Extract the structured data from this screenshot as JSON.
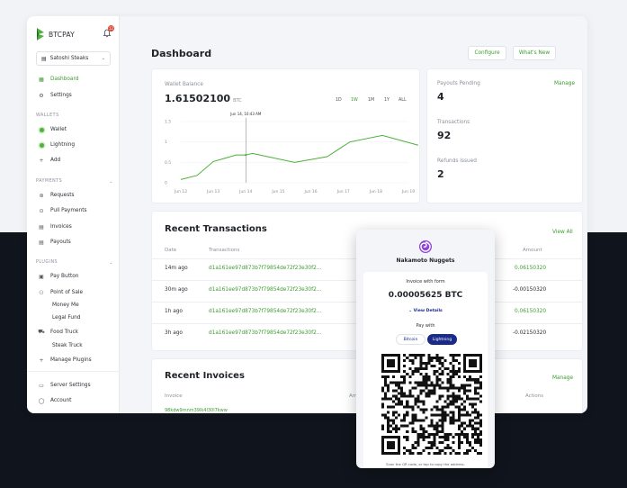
{
  "brand": {
    "name": "BTCPAY",
    "notif_count": "12"
  },
  "store": {
    "name": "Satoshi Steaks"
  },
  "sidebar": {
    "top_items": [
      {
        "label": "Dashboard",
        "icon": "dashboard-icon",
        "active": true
      },
      {
        "label": "Settings",
        "icon": "gear-icon",
        "active": false
      }
    ],
    "wallets_heading": "WALLETS",
    "wallets": [
      {
        "label": "Wallet"
      },
      {
        "label": "Lightning"
      },
      {
        "label": "Add"
      }
    ],
    "payments_heading": "PAYMENTS",
    "payments": [
      {
        "label": "Requests"
      },
      {
        "label": "Pull Payments"
      },
      {
        "label": "Invoices"
      },
      {
        "label": "Payouts"
      }
    ],
    "plugins_heading": "PLUGINS",
    "plugins": [
      {
        "label": "Pay Button"
      },
      {
        "label": "Point of Sale"
      },
      {
        "label": "Money Me"
      },
      {
        "label": "Legal Fund"
      },
      {
        "label": "Food Truck"
      },
      {
        "label": "Steak Truck"
      },
      {
        "label": "Manage Plugins"
      }
    ],
    "bottom": [
      {
        "label": "Server Settings"
      },
      {
        "label": "Account"
      }
    ]
  },
  "header": {
    "title": "Dashboard",
    "configure": "Configure",
    "whats_new": "What's New"
  },
  "wallet": {
    "label": "Wallet Balance",
    "value": "1.61502100",
    "unit": "BTC",
    "ranges": [
      "1D",
      "1W",
      "1M",
      "1Y",
      "ALL"
    ],
    "active_range": "1W",
    "tooltip": "Jun 14, 10:43 AM"
  },
  "chart_data": {
    "type": "line",
    "x": [
      "Jun 12",
      "Jun 13",
      "Jun 14",
      "Jun 15",
      "Jun 16",
      "Jun 17",
      "Jun 18",
      "Jun 19"
    ],
    "yticks": [
      "1.5",
      "1",
      "0.5",
      "0"
    ],
    "ylim": [
      0,
      1.5
    ],
    "series": [
      {
        "values": [
          0.08,
          0.18,
          0.52,
          0.68,
          0.68,
          0.72,
          0.5,
          0.64,
          1.0,
          1.16,
          0.92
        ]
      }
    ],
    "point_x": [
      12,
      12.5,
      13,
      13.7,
      14,
      14.2,
      15.5,
      16.5,
      17.2,
      18.2,
      19.3
    ],
    "color": "#4caf3a",
    "grid": true,
    "crosshair_at": 14
  },
  "stats": {
    "payouts_label": "Payouts Pending",
    "payouts_manage": "Manage",
    "payouts_value": "4",
    "tx_label": "Transactions",
    "tx_value": "92",
    "refunds_label": "Refunds Issued",
    "refunds_value": "2"
  },
  "transactions": {
    "title": "Recent Transactions",
    "view_all": "View All",
    "headers": {
      "date": "Date",
      "tx": "Transactions",
      "amount": "Amount"
    },
    "rows": [
      {
        "date": "14m ago",
        "hash": "d1a161ee97d873b7f79854de72f23e30f2...",
        "amount": "0.06150320",
        "positive": true
      },
      {
        "date": "30m ago",
        "hash": "d1a161ee97d873b7f79854de72f23e30f2...",
        "amount": "-0.00150320",
        "positive": false
      },
      {
        "date": "1h ago",
        "hash": "d1a161ee97d873b7f79854de72f23e30f2...",
        "amount": "0.06150320",
        "positive": true
      },
      {
        "date": "3h ago",
        "hash": "d1a161ee97d873b7f79854de72f23e30f2...",
        "amount": "-0.02150320",
        "positive": false
      }
    ]
  },
  "invoices": {
    "title": "Recent Invoices",
    "manage": "Manage",
    "headers": {
      "invoice": "Invoice",
      "amount": "Am",
      "actions": "Actions"
    },
    "first_row_id": "98kdw9mnm39lk4l30l7kww"
  },
  "checkout": {
    "store": "Nakamoto Nuggets",
    "label": "Invoice with form",
    "amount": "0.00005625 BTC",
    "details": "View Details",
    "pay_with": "Pay with",
    "methods": [
      "Bitcoin",
      "Lightning"
    ],
    "active_method": "Lightning",
    "footer": "Scan the QR code, or tap to copy the address."
  },
  "colors": {
    "accent": "#3c9b2f",
    "dark_bg": "#10141c",
    "lightning": "#1a2a8a"
  }
}
